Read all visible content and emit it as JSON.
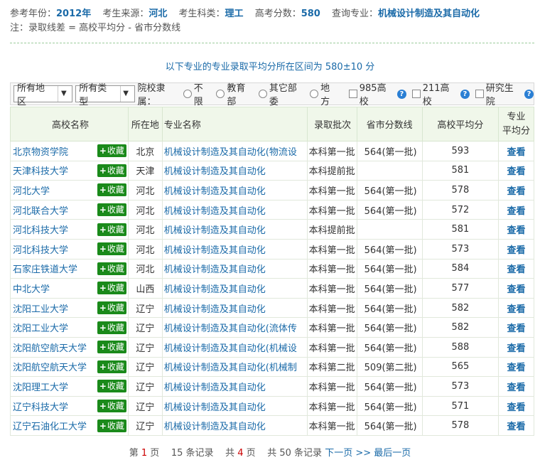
{
  "query": {
    "year_label": "参考年份：",
    "year": "2012年",
    "origin_label": "考生来源：",
    "origin": "河北",
    "category_label": "考生科类：",
    "category": "理工",
    "score_label": "高考分数：",
    "score": "580",
    "major_label": "查询专业：",
    "major": "机械设计制造及其自动化",
    "note": "注：录取线差 = 高校平均分 - 省市分数线"
  },
  "range": {
    "text": "以下专业的专业录取平均分所在区间为",
    "value": "580±10 分"
  },
  "filters": {
    "region_select": "所有地区",
    "type_select": "所有类型",
    "affiliation_label": "院校隶属：",
    "radios": [
      "不限",
      "教育部",
      "其它部委",
      "地方"
    ],
    "checks": [
      "985高校",
      "211高校",
      "研究生院"
    ]
  },
  "table": {
    "headers": {
      "school": "高校名称",
      "location": "所在地",
      "major": "专业名称",
      "batch": "录取批次",
      "line": "省市分数线",
      "avg": "高校平均分",
      "major_avg": "专业\n平均分"
    },
    "fav_label": "收藏",
    "view_label": "查看",
    "rows": [
      {
        "school": "北京物资学院",
        "loc": "北京",
        "major": "机械设计制造及其自动化(物流设",
        "batch": "本科第一批",
        "line": "564(第一批)",
        "avg": "593"
      },
      {
        "school": "天津科技大学",
        "loc": "天津",
        "major": "机械设计制造及其自动化",
        "batch": "本科提前批",
        "line": "",
        "avg": "581"
      },
      {
        "school": "河北大学",
        "loc": "河北",
        "major": "机械设计制造及其自动化",
        "batch": "本科第一批",
        "line": "564(第一批)",
        "avg": "578"
      },
      {
        "school": "河北联合大学",
        "loc": "河北",
        "major": "机械设计制造及其自动化",
        "batch": "本科第一批",
        "line": "564(第一批)",
        "avg": "572"
      },
      {
        "school": "河北科技大学",
        "loc": "河北",
        "major": "机械设计制造及其自动化",
        "batch": "本科提前批",
        "line": "",
        "avg": "581"
      },
      {
        "school": "河北科技大学",
        "loc": "河北",
        "major": "机械设计制造及其自动化",
        "batch": "本科第一批",
        "line": "564(第一批)",
        "avg": "573"
      },
      {
        "school": "石家庄铁道大学",
        "loc": "河北",
        "major": "机械设计制造及其自动化",
        "batch": "本科第一批",
        "line": "564(第一批)",
        "avg": "584"
      },
      {
        "school": "中北大学",
        "loc": "山西",
        "major": "机械设计制造及其自动化",
        "batch": "本科第一批",
        "line": "564(第一批)",
        "avg": "577"
      },
      {
        "school": "沈阳工业大学",
        "loc": "辽宁",
        "major": "机械设计制造及其自动化",
        "batch": "本科第一批",
        "line": "564(第一批)",
        "avg": "582"
      },
      {
        "school": "沈阳工业大学",
        "loc": "辽宁",
        "major": "机械设计制造及其自动化(流体传",
        "batch": "本科第一批",
        "line": "564(第一批)",
        "avg": "582"
      },
      {
        "school": "沈阳航空航天大学",
        "loc": "辽宁",
        "major": "机械设计制造及其自动化(机械设",
        "batch": "本科第一批",
        "line": "564(第一批)",
        "avg": "588"
      },
      {
        "school": "沈阳航空航天大学",
        "loc": "辽宁",
        "major": "机械设计制造及其自动化(机械制",
        "batch": "本科第二批",
        "line": "509(第二批)",
        "avg": "565"
      },
      {
        "school": "沈阳理工大学",
        "loc": "辽宁",
        "major": "机械设计制造及其自动化",
        "batch": "本科第一批",
        "line": "564(第一批)",
        "avg": "573"
      },
      {
        "school": "辽宁科技大学",
        "loc": "辽宁",
        "major": "机械设计制造及其自动化",
        "batch": "本科第一批",
        "line": "564(第一批)",
        "avg": "571"
      },
      {
        "school": "辽宁石油化工大学",
        "loc": "辽宁",
        "major": "机械设计制造及其自动化",
        "batch": "本科第一批",
        "line": "564(第一批)",
        "avg": "578"
      }
    ]
  },
  "pager": {
    "page_prefix": "第",
    "page_num": "1",
    "page_suffix": "页",
    "per_page": "15",
    "per_page_suffix": "条记录",
    "total_prefix": "共",
    "total_pages": "4",
    "total_pages_suffix": "页",
    "total_records_prefix": "共",
    "total_records": "50",
    "total_records_suffix": "条记录",
    "next": "下一页",
    "next_arrows": ">>",
    "last": "最后一页"
  },
  "colors": {
    "link": "#1a6aa8",
    "fav_button": "#1a8a1a",
    "header_bg": "#f0f7ea",
    "page_highlight": "#cc0000"
  }
}
